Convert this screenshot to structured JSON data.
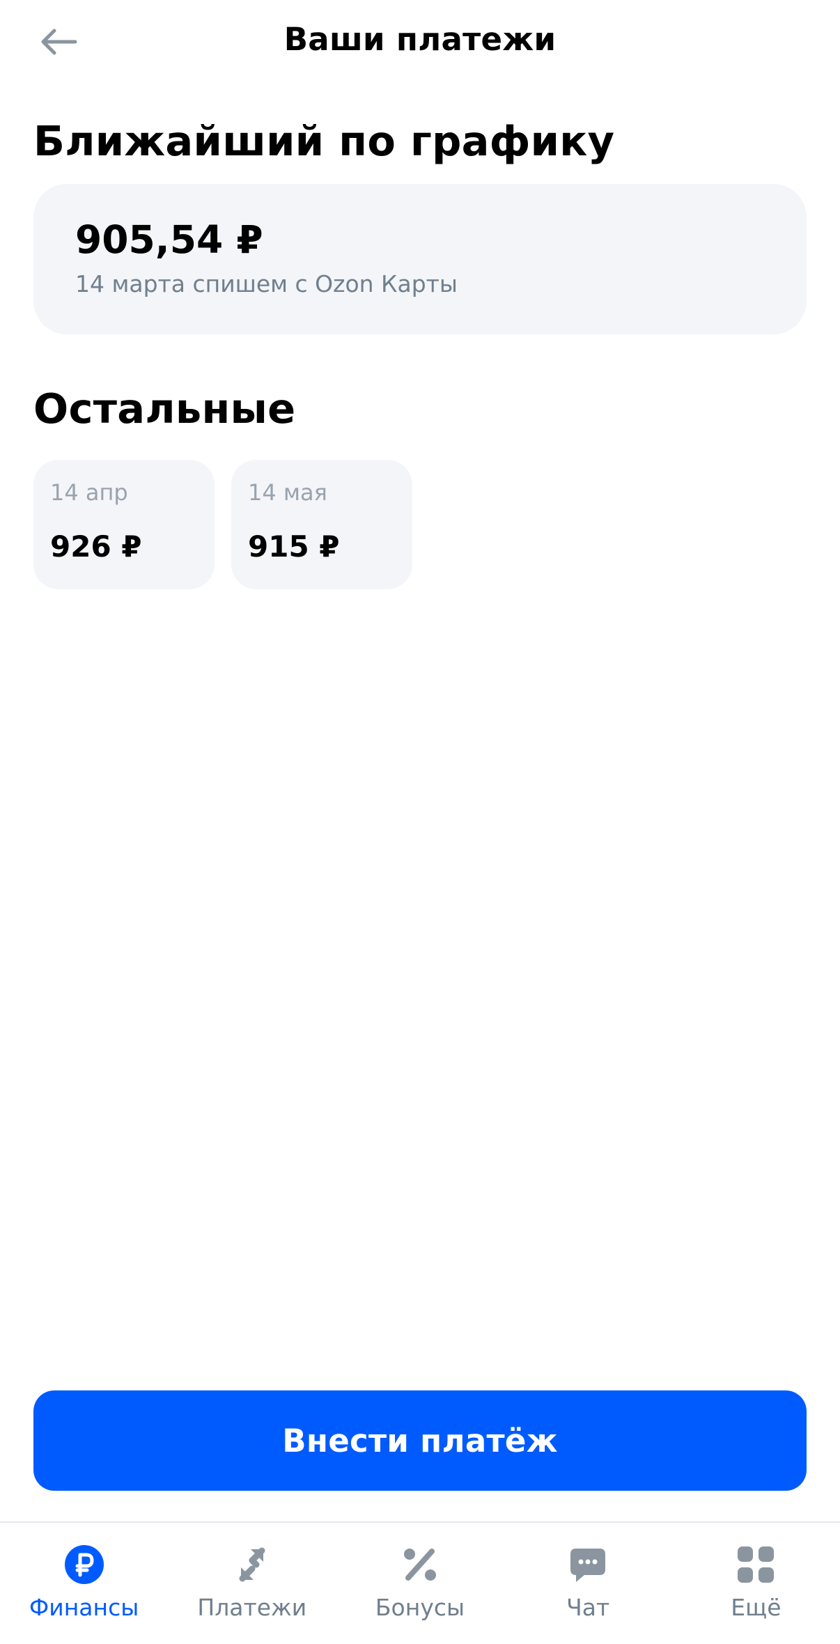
{
  "header": {
    "title": "Ваши платежи"
  },
  "next_payment": {
    "section_title": "Ближайший по графику",
    "amount": "905,54 ₽",
    "description": "14 марта спишем с Ozon Карты"
  },
  "other_payments": {
    "section_title": "Остальные",
    "items": [
      {
        "date": "14 апр",
        "amount": "926 ₽"
      },
      {
        "date": "14 мая",
        "amount": "915 ₽"
      }
    ]
  },
  "pay_button": {
    "label": "Внести платёж"
  },
  "bottom_nav": {
    "items": [
      {
        "label": "Финансы",
        "icon": "ruble-icon",
        "active": true
      },
      {
        "label": "Платежи",
        "icon": "transfer-arrows-icon",
        "active": false
      },
      {
        "label": "Бонусы",
        "icon": "percent-icon",
        "active": false
      },
      {
        "label": "Чат",
        "icon": "chat-bubble-icon",
        "active": false
      },
      {
        "label": "Ещё",
        "icon": "grid-icon",
        "active": false
      }
    ]
  },
  "colors": {
    "accent": "#005bff",
    "card_bg": "#f3f5f9",
    "secondary_text": "#707f8d",
    "muted_text": "#98a3ae",
    "icon_gray": "#8a959f"
  }
}
